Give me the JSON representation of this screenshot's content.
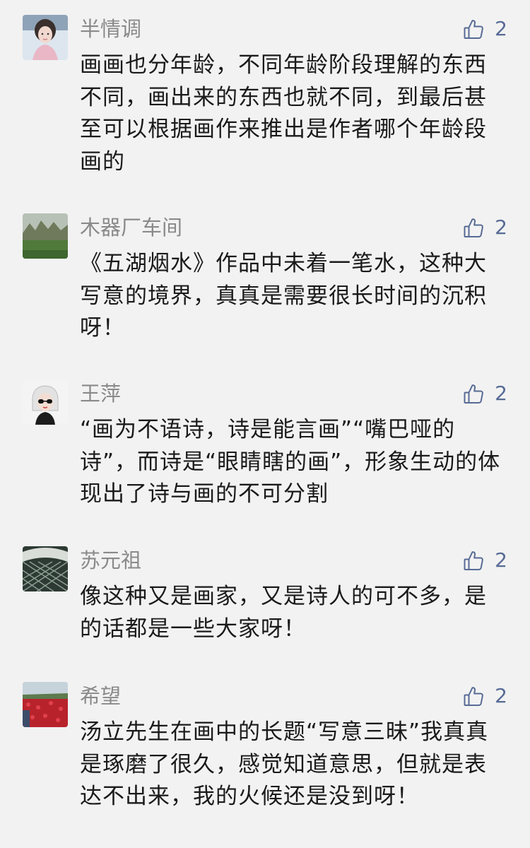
{
  "comments": [
    {
      "username": "半情调",
      "likes": "2",
      "text": "画画也分年龄，不同年龄阶段理解的东西不同，画出来的东西也就不同，到最后甚至可以根据画作来推出是作者哪个年龄段画的"
    },
    {
      "username": "木器厂车间",
      "likes": "2",
      "text": "《五湖烟水》作品中未着一笔水，这种大写意的境界，真真是需要很长时间的沉积呀！"
    },
    {
      "username": "王萍",
      "likes": "2",
      "text": "“画为不语诗，诗是能言画”“嘴巴哑的诗”，而诗是“眼睛瞎的画”，形象生动的体现出了诗与画的不可分割"
    },
    {
      "username": "苏元祖",
      "likes": "2",
      "text": "像这种又是画家，又是诗人的可不多，是的话都是一些大家呀！"
    },
    {
      "username": "希望",
      "likes": "2",
      "text": "汤立先生在画中的长题“写意三昧”我真真是琢磨了很久，感觉知道意思，但就是表达不出来，我的火候还是没到呀！"
    }
  ],
  "colors": {
    "background": "#f2f2f2",
    "username": "#8a8a8a",
    "like_accent": "#576b95",
    "text": "#1a1a1a"
  },
  "icons": {
    "like": "thumbs-up-outline-icon"
  }
}
